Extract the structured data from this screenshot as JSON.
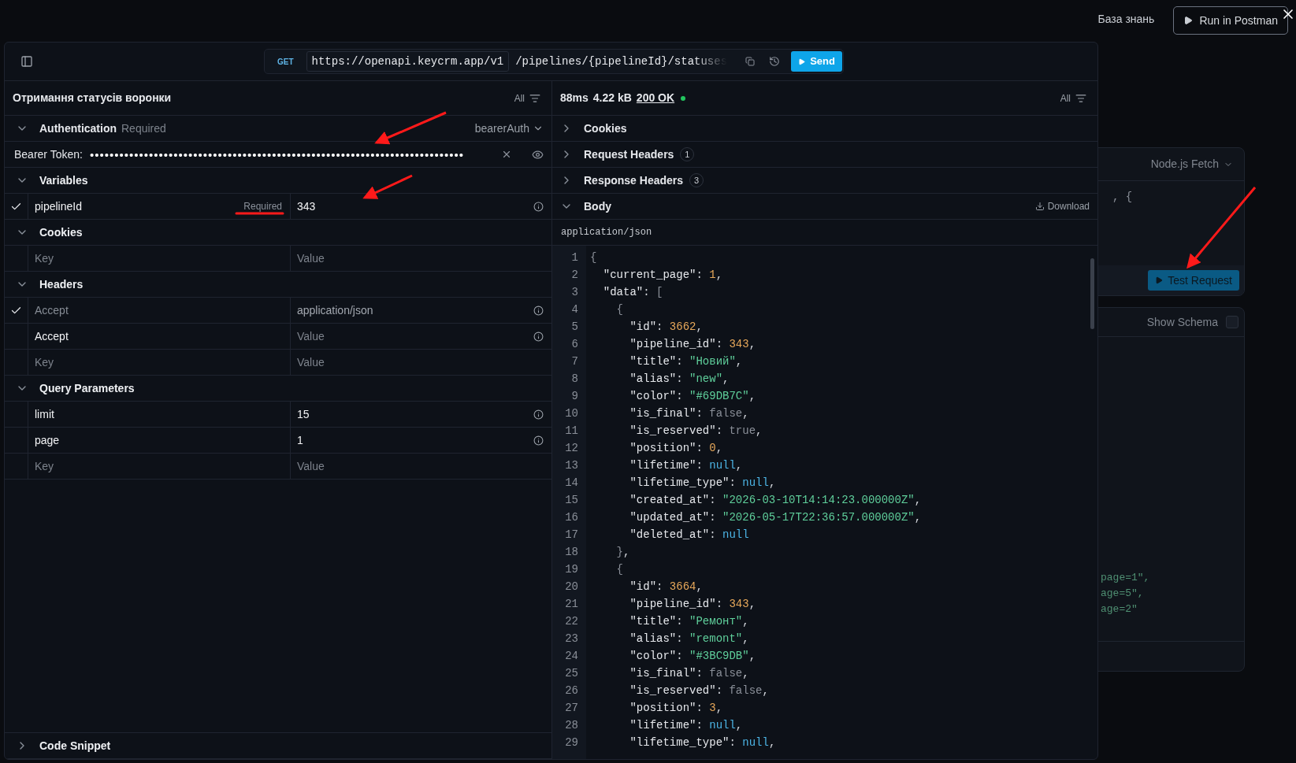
{
  "topbar": {
    "link": "База знань",
    "run_button": "Run in Postman"
  },
  "request_bar": {
    "method": "GET",
    "base_url": "https://openapi.keycrm.app/v1",
    "path": "/pipelines/{pipelineId}/statuses",
    "send": "Send"
  },
  "request": {
    "title": "Отримання статусів воронки",
    "filter": "All",
    "auth": {
      "title": "Authentication",
      "hint": "Required",
      "expanded": true,
      "scheme": "bearerAuth",
      "token_label": "Bearer Token:",
      "token": "••••••••••••••••••••••••••••••••••••••••••••••••••••••••••••••••••••••••••••"
    },
    "sections": [
      {
        "title": "Variables",
        "expanded": true,
        "rows": [
          {
            "checked": true,
            "key": "pipelineId",
            "tag": "Required",
            "value": "343",
            "info": true,
            "readonly": false
          }
        ]
      },
      {
        "title": "Cookies",
        "expanded": true,
        "rows": [
          {
            "checked": false,
            "key_placeholder": "Key",
            "value_placeholder": "Value",
            "info": false
          }
        ]
      },
      {
        "title": "Headers",
        "expanded": true,
        "rows": [
          {
            "checked": true,
            "key": "Accept",
            "value": "application/json",
            "info": true,
            "readonly": true
          },
          {
            "checked": false,
            "key": "Accept",
            "value_placeholder": "Value",
            "info": true,
            "readonly": false
          },
          {
            "checked": false,
            "key_placeholder": "Key",
            "value_placeholder": "Value",
            "info": false
          }
        ]
      },
      {
        "title": "Query Parameters",
        "expanded": true,
        "rows": [
          {
            "checked": false,
            "key": "limit",
            "value": "15",
            "info": true,
            "readonly": false
          },
          {
            "checked": false,
            "key": "page",
            "value": "1",
            "info": true,
            "readonly": false
          },
          {
            "checked": false,
            "key_placeholder": "Key",
            "value_placeholder": "Value",
            "info": false
          }
        ]
      }
    ],
    "code_snippet": {
      "title": "Code Snippet",
      "expanded": false
    }
  },
  "response": {
    "time": "88ms",
    "size": "4.22 kB",
    "status": "200 OK",
    "filter": "All",
    "sections": [
      {
        "title": "Cookies",
        "expanded": false
      },
      {
        "title": "Request Headers",
        "count": "1",
        "expanded": false
      },
      {
        "title": "Response Headers",
        "count": "3",
        "expanded": false
      },
      {
        "title": "Body",
        "expanded": true,
        "action": "Download"
      }
    ],
    "content_type": "application/json",
    "lines": [
      {
        "n": "1",
        "code": "{"
      },
      {
        "n": "2",
        "code": "  \"current_page\": 1,"
      },
      {
        "n": "3",
        "code": "  \"data\": ["
      },
      {
        "n": "4",
        "code": "    {"
      },
      {
        "n": "5",
        "code": "      \"id\": 3662,"
      },
      {
        "n": "6",
        "code": "      \"pipeline_id\": 343,"
      },
      {
        "n": "7",
        "code": "      \"title\": \"Новий\","
      },
      {
        "n": "8",
        "code": "      \"alias\": \"new\","
      },
      {
        "n": "9",
        "code": "      \"color\": \"#69DB7C\","
      },
      {
        "n": "10",
        "code": "      \"is_final\": false,"
      },
      {
        "n": "11",
        "code": "      \"is_reserved\": true,"
      },
      {
        "n": "12",
        "code": "      \"position\": 0,"
      },
      {
        "n": "13",
        "code": "      \"lifetime\": null,"
      },
      {
        "n": "14",
        "code": "      \"lifetime_type\": null,"
      },
      {
        "n": "15",
        "code": "      \"created_at\": \"2026-03-10T14:14:23.000000Z\","
      },
      {
        "n": "16",
        "code": "      \"updated_at\": \"2026-05-17T22:36:57.000000Z\","
      },
      {
        "n": "17",
        "code": "      \"deleted_at\": null"
      },
      {
        "n": "18",
        "code": "    },"
      },
      {
        "n": "19",
        "code": "    {"
      },
      {
        "n": "20",
        "code": "      \"id\": 3664,"
      },
      {
        "n": "21",
        "code": "      \"pipeline_id\": 343,"
      },
      {
        "n": "22",
        "code": "      \"title\": \"Ремонт\","
      },
      {
        "n": "23",
        "code": "      \"alias\": \"remont\","
      },
      {
        "n": "24",
        "code": "      \"color\": \"#3BC9DB\","
      },
      {
        "n": "25",
        "code": "      \"is_final\": false,"
      },
      {
        "n": "26",
        "code": "      \"is_reserved\": false,"
      },
      {
        "n": "27",
        "code": "      \"position\": 3,"
      },
      {
        "n": "28",
        "code": "      \"lifetime\": null,"
      },
      {
        "n": "29",
        "code": "      \"lifetime_type\": null,"
      }
    ]
  },
  "background": {
    "language": "Node.js Fetch",
    "code_fragment": ", {",
    "test_button": "Test Request",
    "show_schema": "Show Schema",
    "show_schema_checked": false,
    "schema_fragments": [
      "page=1\",",
      "age=5\",",
      "age=2\""
    ]
  }
}
